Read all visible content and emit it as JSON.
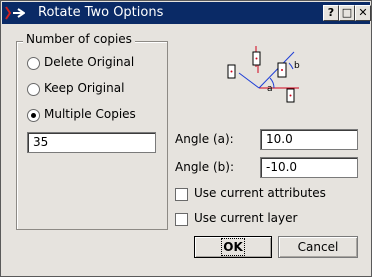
{
  "window": {
    "title": "Rotate Two Options"
  },
  "titlebar_buttons": [
    {
      "name": "help-button",
      "glyph": "?"
    },
    {
      "name": "maximize-button",
      "glyph": "□"
    },
    {
      "name": "close-button",
      "glyph": "✕"
    }
  ],
  "copies": {
    "group_title": "Number of copies",
    "options": [
      {
        "label": "Delete Original",
        "selected": false
      },
      {
        "label": "Keep Original",
        "selected": false
      },
      {
        "label": "Multiple Copies",
        "selected": true
      }
    ],
    "count_value": "35"
  },
  "angles": {
    "a_label": "Angle (a):",
    "a_value": "10.0",
    "b_label": "Angle (b):",
    "b_value": "-10.0"
  },
  "options": {
    "use_current_attributes": {
      "label": "Use current attributes",
      "checked": false
    },
    "use_current_layer": {
      "label": "Use current layer",
      "checked": false
    }
  },
  "buttons": {
    "ok": "OK",
    "cancel": "Cancel"
  },
  "diagram": {
    "label_a": "a",
    "label_b": "b"
  },
  "colors": {
    "titlebar": "#0a2a66",
    "dialog_bg": "#e6e3de",
    "diagram_red": "#d0021b",
    "diagram_blue": "#1f3fd6"
  }
}
